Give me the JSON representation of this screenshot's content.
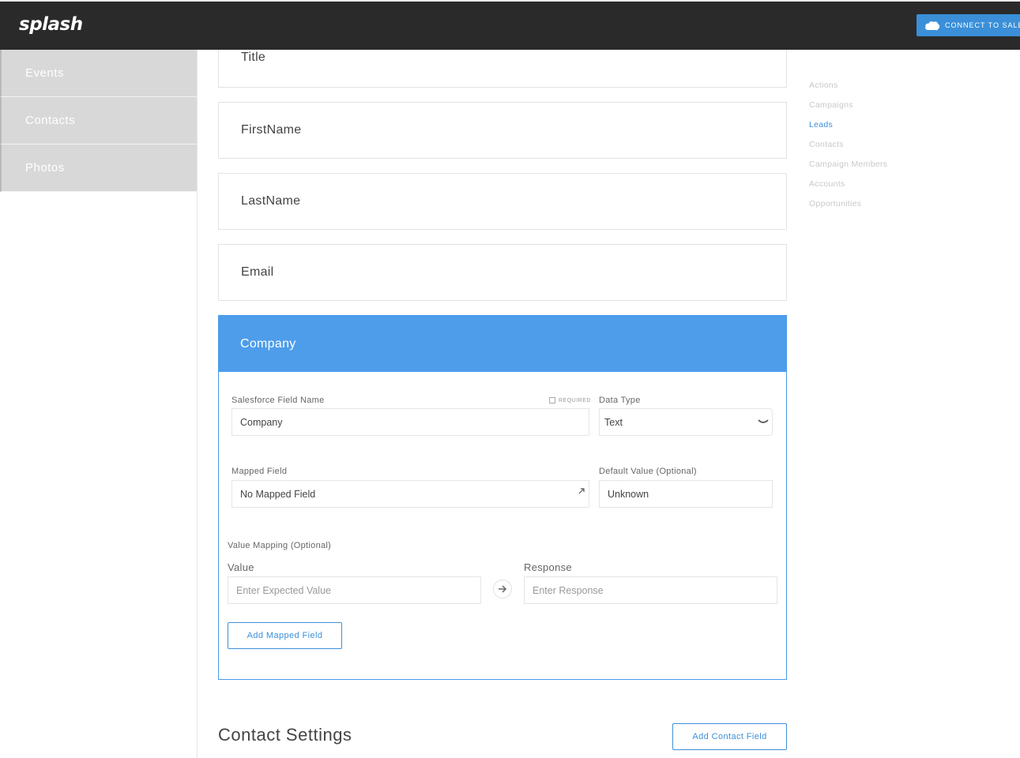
{
  "header": {
    "logo": "splash",
    "connect_label": "CONNECT TO SALES"
  },
  "sidebar": {
    "items": [
      {
        "label": "Events"
      },
      {
        "label": "Contacts"
      },
      {
        "label": "Photos"
      }
    ]
  },
  "fields": {
    "title": "Title",
    "first_name": "FirstName",
    "last_name": "LastName",
    "email": "Email"
  },
  "company": {
    "header": "Company",
    "sf_field_label": "Salesforce Field Name",
    "sf_field_value": "Company",
    "required_label": "REQUIRED",
    "data_type_label": "Data Type",
    "data_type_value": "Text",
    "mapped_field_label": "Mapped Field",
    "mapped_field_value": "No Mapped Field",
    "default_value_label": "Default Value (Optional)",
    "default_value_value": "Unknown",
    "value_mapping_label": "Value Mapping (Optional)",
    "value_label": "Value",
    "value_placeholder": "Enter Expected Value",
    "response_label": "Response",
    "response_placeholder": "Enter Response",
    "add_mapped_field": "Add Mapped Field"
  },
  "contact_settings": {
    "title": "Contact Settings",
    "add_contact_field": "Add Contact Field"
  },
  "right_nav": {
    "items": [
      {
        "label": "Actions"
      },
      {
        "label": "Campaigns"
      },
      {
        "label": "Leads"
      },
      {
        "label": "Contacts"
      },
      {
        "label": "Campaign Members"
      },
      {
        "label": "Accounts"
      },
      {
        "label": "Opportunities"
      }
    ],
    "active_index": 2
  },
  "colors": {
    "accent": "#4d9deb",
    "topbar": "#2a2a2a",
    "sidebar_item": "#d8d8d8"
  }
}
